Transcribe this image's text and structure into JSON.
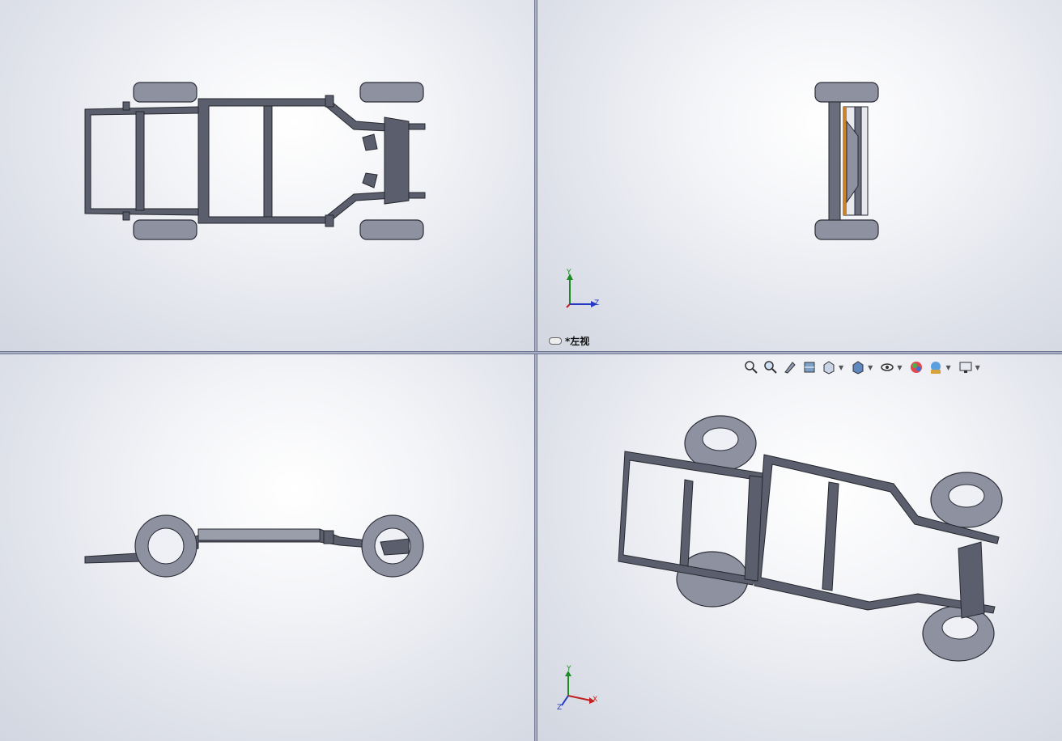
{
  "viewports": {
    "top_right": {
      "view_name": "*左视"
    }
  },
  "axes": {
    "x": "X",
    "y": "Y",
    "z": "Z"
  },
  "toolbar": {
    "icons": [
      "zoom-to-fit-icon",
      "zoom-to-area-icon",
      "previous-view-icon",
      "section-view-icon",
      "view-orientation-icon",
      "display-style-icon",
      "hide-show-items-icon",
      "edit-appearance-icon",
      "apply-scene-icon",
      "view-settings-icon"
    ]
  },
  "colors": {
    "frame": "#5b5e6c",
    "tire": "#8a8d9c",
    "accent_orange": "#c9822e"
  }
}
